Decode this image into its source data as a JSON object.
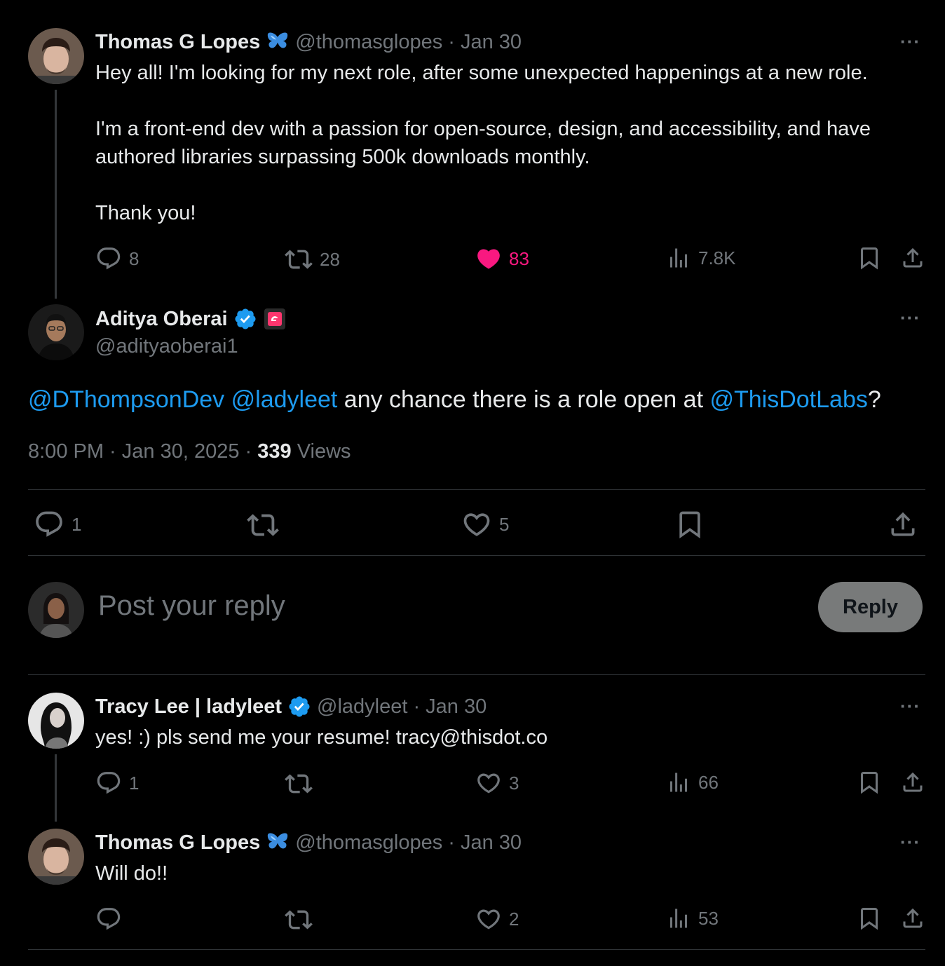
{
  "tweet1": {
    "name": "Thomas G Lopes",
    "emoji_icon": "butterfly-icon",
    "handle": "@thomasglopes",
    "sep": "·",
    "date": "Jan 30",
    "text": "Hey all! I'm looking for my next role, after some unexpected happenings at a new role.\n\nI'm a front-end dev with a passion for open-source, design, and accessibility, and have authored libraries surpassing 500k downloads monthly.\n\nThank you!",
    "replies": "8",
    "reposts": "28",
    "likes": "83",
    "views": "7.8K"
  },
  "main": {
    "name": "Aditya Oberai",
    "handle": "@adityaoberai1",
    "mention1": "@DThompsonDev",
    "mention2": "@ladyleet",
    "text_mid": " any chance there is a role open at ",
    "mention3": "@ThisDotLabs",
    "text_end": "?",
    "time": "8:00 PM · Jan 30, 2025 · ",
    "views_count": "339",
    "views_label": " Views",
    "replies": "1",
    "likes": "5"
  },
  "compose": {
    "placeholder": "Post your reply",
    "button": "Reply"
  },
  "tweet2": {
    "name": "Tracy Lee | ladyleet",
    "handle": "@ladyleet",
    "sep": "·",
    "date": "Jan 30",
    "text": "yes! :) pls send me your resume! tracy@thisdot.co",
    "replies": "1",
    "likes": "3",
    "views": "66"
  },
  "tweet3": {
    "name": "Thomas G Lopes",
    "handle": "@thomasglopes",
    "sep": "·",
    "date": "Jan 30",
    "text": "Will do!!",
    "likes": "2",
    "views": "53"
  },
  "more_label": "···",
  "colors": {
    "accent": "#1d9bf0",
    "like": "#f91880",
    "muted": "#71767b",
    "bg": "#000000"
  }
}
